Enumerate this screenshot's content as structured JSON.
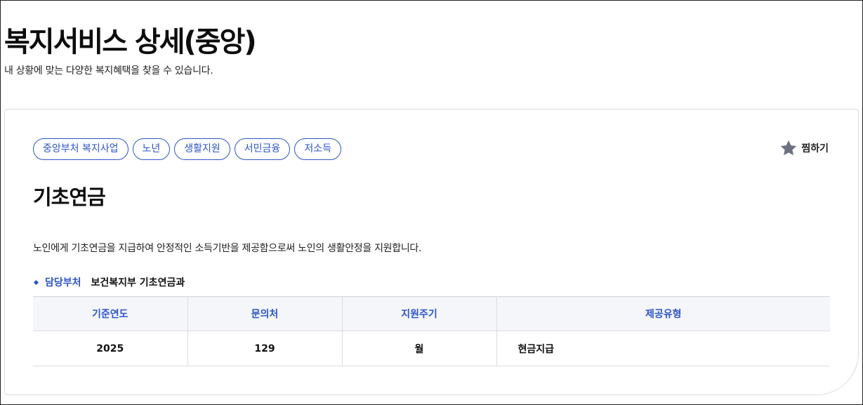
{
  "header": {
    "title": "복지서비스 상세(중앙)",
    "subtitle": "내 상황에 맞는 다양한 복지혜택을 찾을 수 있습니다."
  },
  "service": {
    "tags": [
      "중앙부처 복지사업",
      "노년",
      "생활지원",
      "서민금융",
      "저소득"
    ],
    "bookmark_label": "찜하기",
    "bookmark_icon": "star-icon",
    "title": "기초연금",
    "description": "노인에게 기초연금을 지급하여 안정적인 소득기반을 제공함으로써 노인의 생활안정을 지원합니다.",
    "department": {
      "label": "담당부처",
      "value": "보건복지부 기초연금과"
    },
    "table": {
      "headers": [
        "기준연도",
        "문의처",
        "지원주기",
        "제공유형"
      ],
      "row": [
        "2025",
        "129",
        "월",
        "현금지급"
      ]
    }
  },
  "colors": {
    "accent": "#2e55c7",
    "table_header_bg": "#f4f6fa",
    "star": "#6b7180"
  }
}
